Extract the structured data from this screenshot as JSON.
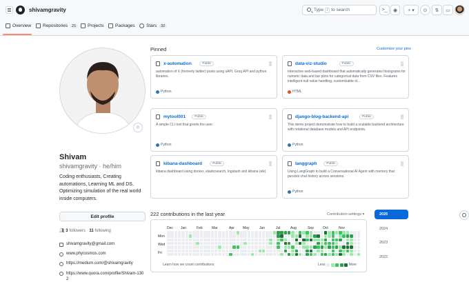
{
  "header": {
    "username": "shivamgravity",
    "search_prefix": "Type",
    "search_key": "/",
    "search_suffix": "to search",
    "icons": [
      "menu-icon",
      "github-logo-icon",
      "search-icon",
      "terminal-icon",
      "copilot-icon",
      "plus-icon",
      "issues-icon",
      "pull-requests-icon",
      "inbox-icon",
      "avatar"
    ]
  },
  "tabs": [
    {
      "label": "Overview",
      "count": ""
    },
    {
      "label": "Repositories",
      "count": "21"
    },
    {
      "label": "Projects",
      "count": ""
    },
    {
      "label": "Packages",
      "count": ""
    },
    {
      "label": "Stars",
      "count": "32"
    }
  ],
  "profile": {
    "name": "Shivam",
    "login": "shivamgravity",
    "pronouns": "· he/him",
    "bio": "Coding enthusiasts, Creating automations, Learning ML and DS, Optimizing simulation of the real world inside computers.",
    "edit_label": "Edit profile",
    "followers": "3",
    "followers_label": "followers",
    "following": "11",
    "following_label": "following",
    "email": "shivamgravity@gmail.com",
    "links": [
      "www.phycosmos.com",
      "https://medium.com/@shivamgravity",
      "https://www.quora.com/profile/Shivam-130",
      "2"
    ]
  },
  "pinned": {
    "title": "Pinned",
    "customize": "Customize your pins",
    "repos": [
      {
        "name": "x-automation",
        "badge": "Public",
        "desc": "automation of X (formerly twitter) posts using xAPI, Groq API and python libraries.",
        "lang": "Python",
        "lang_color": "#3572A5"
      },
      {
        "name": "data-viz-studio",
        "badge": "Public",
        "desc": "Interactive web-based dashboard that automatically generates histograms for numeric data and bar plots for categorical data from CSV files. Features intelligent null value handling, customizable st...",
        "lang": "HTML",
        "lang_color": "#e34c26"
      },
      {
        "name": "mytool001",
        "badge": "Public",
        "desc": "A simple CLI tool that greets the user.",
        "lang": "Python",
        "lang_color": "#3572A5"
      },
      {
        "name": "django-blog-backend-api",
        "badge": "Public",
        "desc": "This demo project demonstrate how to build a scalable backend architecture with relational database models and API endpoints.",
        "lang": "Python",
        "lang_color": "#3572A5"
      },
      {
        "name": "kibana-dashboard",
        "badge": "Public",
        "desc": "kibana dashboard using docker, elasticsearch, logstash and kibana (elk)",
        "lang": "",
        "lang_color": ""
      },
      {
        "name": "langgraph",
        "badge": "Public",
        "desc": "Using LangGraph to build a Conversational AI Agent with memory that persists chat history across sessions.",
        "lang": "Python",
        "lang_color": "#3572A5"
      }
    ]
  },
  "contributions": {
    "title": "222 contributions in the last year",
    "settings": "Contribution settings ▾",
    "months": [
      "Dec",
      "Jan",
      "Feb",
      "Mar",
      "Apr",
      "May",
      "Jun",
      "Jul",
      "Aug",
      "Sep",
      "Oct",
      "Nov"
    ],
    "days": [
      "Mon",
      "Wed",
      "Fri"
    ],
    "learn": "Learn how we count contributions",
    "less": "Less",
    "more": "More",
    "colors": [
      "#ebedf0",
      "#9be9a8",
      "#40c463",
      "#30a14e",
      "#216e39"
    ]
  },
  "years": [
    "2025",
    "2024",
    "2023",
    "2022"
  ]
}
